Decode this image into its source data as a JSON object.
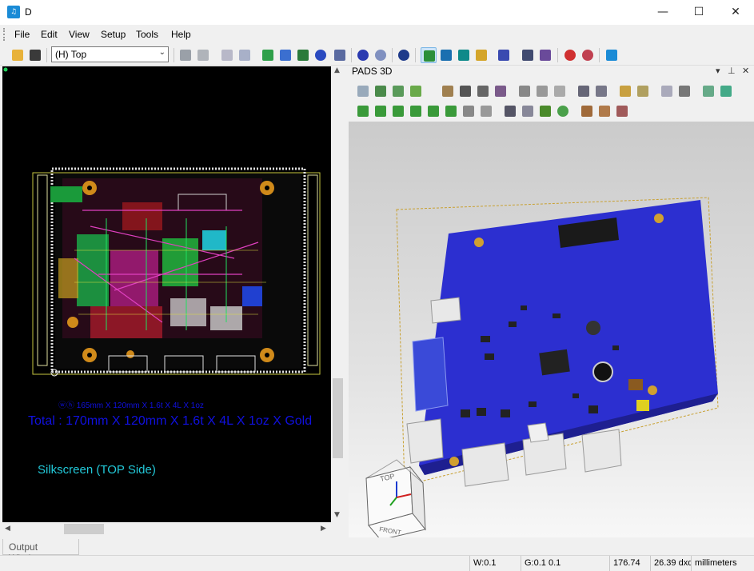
{
  "window": {
    "title": "D",
    "min_glyph": "—",
    "max_glyph": "☐",
    "close_glyph": "✕"
  },
  "menu": [
    "File",
    "Edit",
    "View",
    "Setup",
    "Tools",
    "Help"
  ],
  "toolbar": {
    "layer_value": "(H) Top"
  },
  "pcb": {
    "size_small": "ⓦⓗ 165mm X 120mm X 1.6t X 4L X 1oz",
    "size_total": "Total : 170mm X 120mm X 1.6t X 4L X 1oz X Gold",
    "silkscreen": "Silkscreen (TOP Side)"
  },
  "pads3d": {
    "title": "PADS 3D",
    "cube_top": "TOP",
    "cube_front": "FRONT"
  },
  "output": {
    "tab_label": "Output Window"
  },
  "status": {
    "width": "W:0.1",
    "grid": "G:0.1 0.1",
    "x": "176.74",
    "y": "26.39 dxd",
    "units": "millimeters"
  },
  "colors": {
    "board_blue": "#2c2fd0",
    "pcb_bg": "#000000",
    "text_blue": "#1010e0",
    "text_cyan": "#22c8d8",
    "accent": "#0078d7"
  }
}
